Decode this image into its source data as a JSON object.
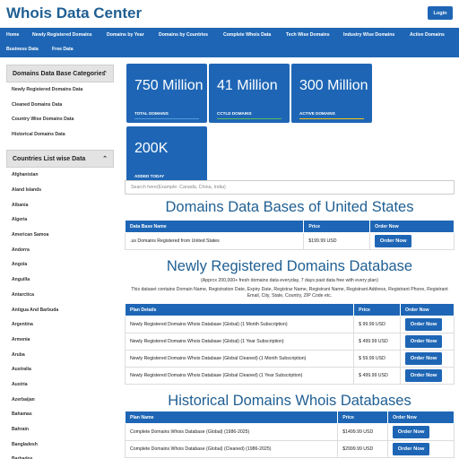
{
  "header": {
    "title": "Whois Data Center",
    "login_label": "Login"
  },
  "nav": {
    "items": [
      "Home",
      "Newly Registered Domains",
      "Domains by Year",
      "Domains by Countries",
      "Complete Whois Data",
      "Tech Wise Domains",
      "Industry Wise Domains",
      "Active Domains",
      "Business Data",
      "Free Data"
    ]
  },
  "sidebar": {
    "categories_title": "Domains Data Base Categories",
    "categories": [
      "Newly Registered Domains Data",
      "Cleaned Domains Data",
      "Country Wise Domains Data",
      "Historical Domains Data"
    ],
    "countries_title": "Countries List wise Data",
    "countries": [
      "Afghanistan",
      "Aland Islands",
      "Albania",
      "Algeria",
      "American Samoa",
      "Andorra",
      "Angola",
      "Anguilla",
      "Antarctica",
      "Antigua And Barbuda",
      "Argentina",
      "Armenia",
      "Aruba",
      "Australia",
      "Austria",
      "Azerbaijan",
      "Bahamas",
      "Bahrain",
      "Bangladesh",
      "Barbados"
    ]
  },
  "stats": [
    {
      "number": "750 Million",
      "label": "TOTAL DOMAINS",
      "bar_color": "#4f9be0"
    },
    {
      "number": "41 Million",
      "label": "CCTLD DOMAINS",
      "bar_color": "#5cb85c"
    },
    {
      "number": "300 Million",
      "label": "ACTIVE DOMAINS",
      "bar_color": "#f0c419"
    },
    {
      "number": "200K",
      "label": "ADDED TODAY",
      "bar_color": "#e0584f"
    }
  ],
  "search": {
    "placeholder": "Search here(Example: Canada, China, India)"
  },
  "us_section": {
    "title": "Domains Data Bases of United States",
    "headers": [
      "Data Base Name",
      "Price",
      "Order Now"
    ],
    "rows": [
      {
        "name": ".us Domains Registered from United States",
        "price": "$199.99 USD",
        "action": "Order Now"
      }
    ]
  },
  "newly_section": {
    "title": "Newly Registered Domains Database",
    "sub1": "(Apprcx 200,000+ fresh domains data everyday, 7 days past data free with every plan)",
    "sub2": "This dataset contains Domain Name, Registration Date, Expiry Date, Registrar Name, Registrant Name, Registrant Address, Registrant Phone, Registrant Email, City, State, Country, ZIP Code etc.",
    "headers": [
      "Plan Details",
      "Price",
      "Order Now"
    ],
    "rows": [
      {
        "name": "Newly Registered Domains Whois Database (Global) (1 Month Subscription)",
        "price": "$ 99.99 USD",
        "action": "Order Now"
      },
      {
        "name": "Newly Registered Domains Whois Database (Global) (1 Year Subscription)",
        "price": "$ 499.99 USD",
        "action": "Order Now"
      },
      {
        "name": "Newly Registered Domains Whois Database (Global Cleaned) (1 Month Subscription)",
        "price": "$ 59.99 USD",
        "action": "Order Now"
      },
      {
        "name": "Newly Registered Domains Whois Database (Global Cleaned) (1 Year Subscription)",
        "price": "$ 499.99 USD",
        "action": "Order Now"
      }
    ]
  },
  "historical_section": {
    "title": "Historical Domains Whois Databases",
    "headers": [
      "Plan Name",
      "Price",
      "Order Now"
    ],
    "rows": [
      {
        "name": "Complete Domains Whois Database (Global) (1986-2025)",
        "price": "$1499.99 USD",
        "action": "Order Now"
      },
      {
        "name": "Complete Domains Whois Database (Global) (Cleaned) (1986-2025)",
        "price": "$2999.99 USD",
        "action": "Order Now"
      }
    ]
  }
}
